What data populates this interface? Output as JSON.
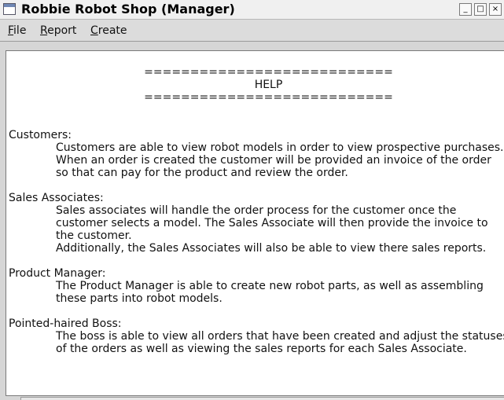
{
  "window": {
    "title": "Robbie Robot Shop (Manager)",
    "controls": {
      "minimize": "_",
      "maximize": "□",
      "close": "×"
    }
  },
  "menu": {
    "items": [
      "File",
      "Report",
      "Create"
    ]
  },
  "help": {
    "separator_top": "===========================",
    "heading": "HELP",
    "separator_bottom": "===========================",
    "sections": [
      {
        "title": "Customers:",
        "lines": [
          "Customers are able to view robot models in order to view prospective purchases.",
          "When an order is created the customer will be provided an invoice of the order",
          "so that can pay for the product and review the order."
        ]
      },
      {
        "title": "Sales Associates:",
        "lines": [
          "Sales associates will handle the order process for the customer once the",
          "customer selects a model. The Sales Associate will then provide the invoice to",
          "the customer.",
          "Additionally, the Sales Associates will also be able to view there sales reports."
        ]
      },
      {
        "title": "Product Manager:",
        "lines": [
          "The Product Manager is able to create new robot parts, as well as assembling",
          "these parts into robot models."
        ]
      },
      {
        "title": "Pointed-haired Boss:",
        "lines": [
          "The boss is able to view all orders that have been created and adjust the statuses",
          "of the orders as well as viewing the sales reports for each Sales Associate."
        ]
      }
    ]
  }
}
